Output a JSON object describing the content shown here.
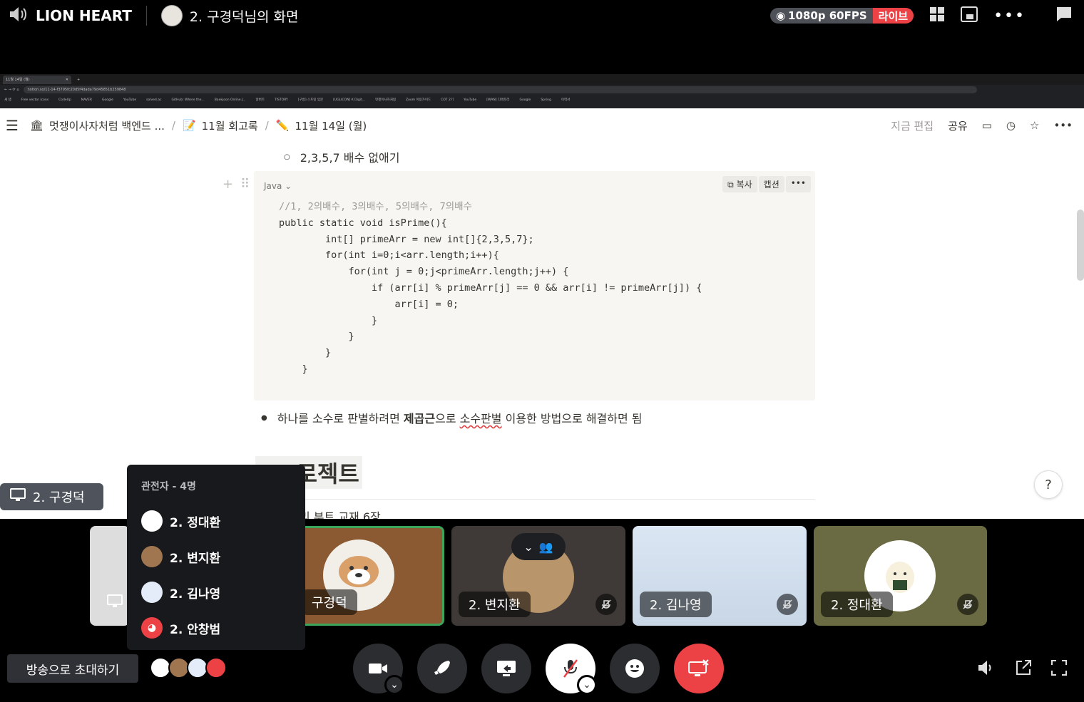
{
  "app": {
    "name": "LION HEART",
    "window_title": "2. 구경덕님의 화면"
  },
  "quality": {
    "label": "1080p 60FPS",
    "live_label": "라이브"
  },
  "browser": {
    "tab_title": "11월 14일 (월)",
    "url": "notion.so/11-14-f3795fc20d5f4dada79d45851b259848",
    "bookmarks": [
      "새 탭",
      "Free vector icons",
      "CodeUp",
      "NAVER",
      "Google",
      "YouTube",
      "solved.ac",
      "GitHub: Where the...",
      "Baekjoon Online J...",
      "알버트",
      "TISTORY",
      "[구름] 스프링 입문",
      "[UGLICON] K Digit...",
      "멋쟁이사자처럼",
      "Zoom 이용가이드",
      "COT 2기",
      "YouTube",
      "[WAN] 디렉토리",
      "Google",
      "Spring",
      "이력서"
    ]
  },
  "notion": {
    "breadcrumbs": [
      "멋쟁이사자처럼 백엔드 ...",
      "11월 회고록",
      "11월 14일 (월)"
    ],
    "actions": {
      "edit": "지금 편집",
      "share": "공유"
    },
    "sub_bullet": "2,3,5,7 배수 없애기",
    "code": {
      "language": "Java",
      "copy_label": "복사",
      "caption_label": "캡션",
      "lines": [
        "//1, 2의배수, 3의배수, 5의배수, 7의배수",
        "public static void isPrime(){",
        "        int[] primeArr = new int[]{2,3,5,7};",
        "        for(int i=0;i<arr.length;i++){",
        "            for(int j = 0;j<primeArr.length;j++) {",
        "                if (arr[i] % primeArr[j] == 0 && arr[i] != primeArr[j]) {",
        "                    arr[i] = 0;",
        "                }",
        "            }",
        "        }",
        "    }"
      ]
    },
    "bullet": {
      "before": "하나를 소수로 판별하려면 ",
      "bold": "제곱근",
      "mid": "으로 ",
      "underline": "소수판별",
      "after": " 이용한 방법으로 해결하면 됨"
    },
    "heading": "프로젝트",
    "cut_text": "리 부트 교재 6장",
    "help": "?"
  },
  "streamer_tag": "2. 구경덕",
  "viewers": {
    "title": "관전자 - 4명",
    "list": [
      "2. 정대환",
      "2. 변지환",
      "2. 김나영",
      "2. 안창범"
    ]
  },
  "tiles": [
    {
      "name": "구경덕"
    },
    {
      "name": "2. 변지환"
    },
    {
      "name": "2. 김나영"
    },
    {
      "name": "2. 정대환"
    }
  ],
  "invite_label": "방송으로 초대하기",
  "colors": {
    "live": "#ed4245",
    "hangup": "#ed4245",
    "speaking": "#3ba55c",
    "notion_text": "#37352f"
  }
}
